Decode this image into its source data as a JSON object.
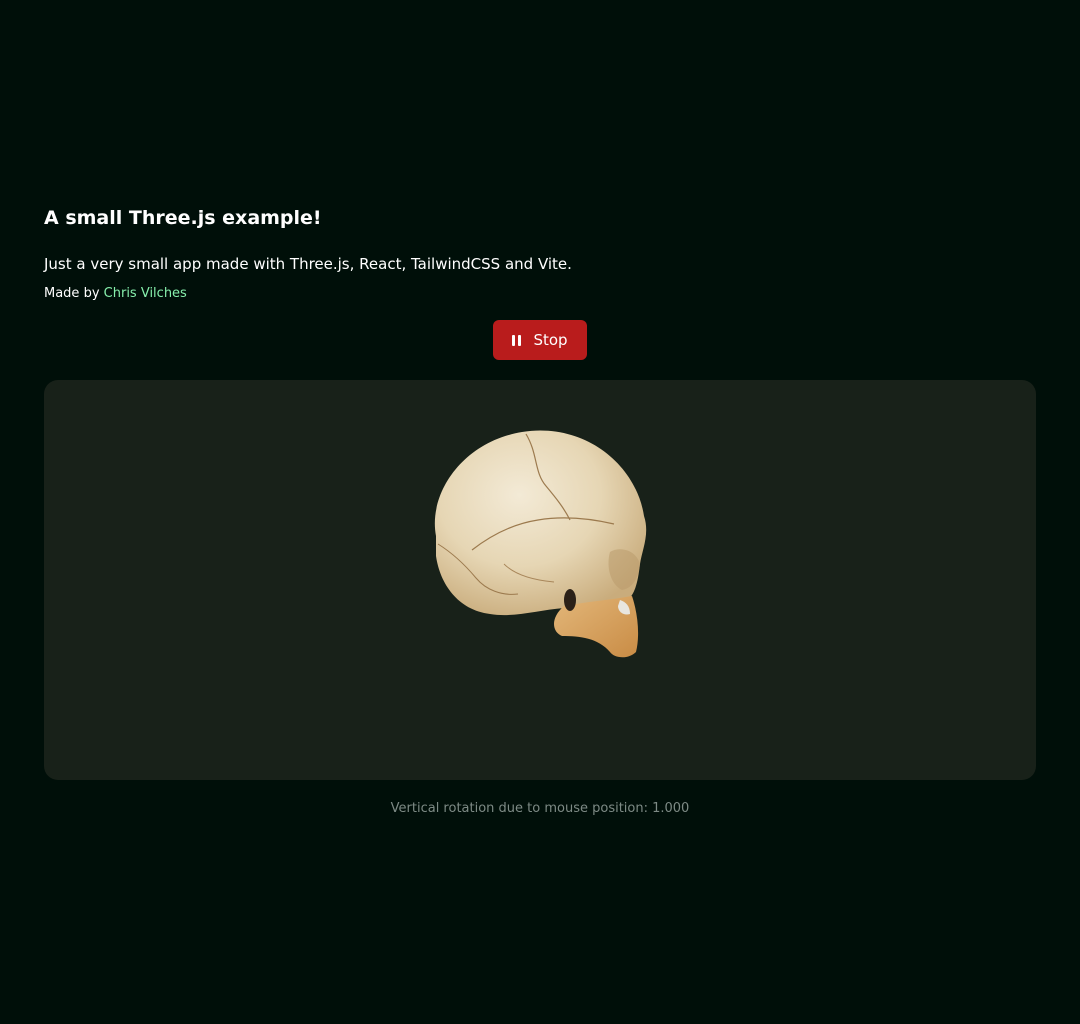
{
  "header": {
    "title": "A small Three.js example!",
    "description": "Just a very small app made with Three.js, React, TailwindCSS and Vite.",
    "credit_prefix": "Made by",
    "author_link_text": "Chris Vilches"
  },
  "controls": {
    "stop_label": "Stop",
    "stop_icon": "pause-icon"
  },
  "viewer": {
    "model": "skull",
    "rotation_readout": "Vertical rotation due to mouse position: 1.000"
  },
  "colors": {
    "background": "#000f09",
    "panel": "#182119",
    "accent_link": "#86efac",
    "stop_button": "#b91c1c"
  }
}
